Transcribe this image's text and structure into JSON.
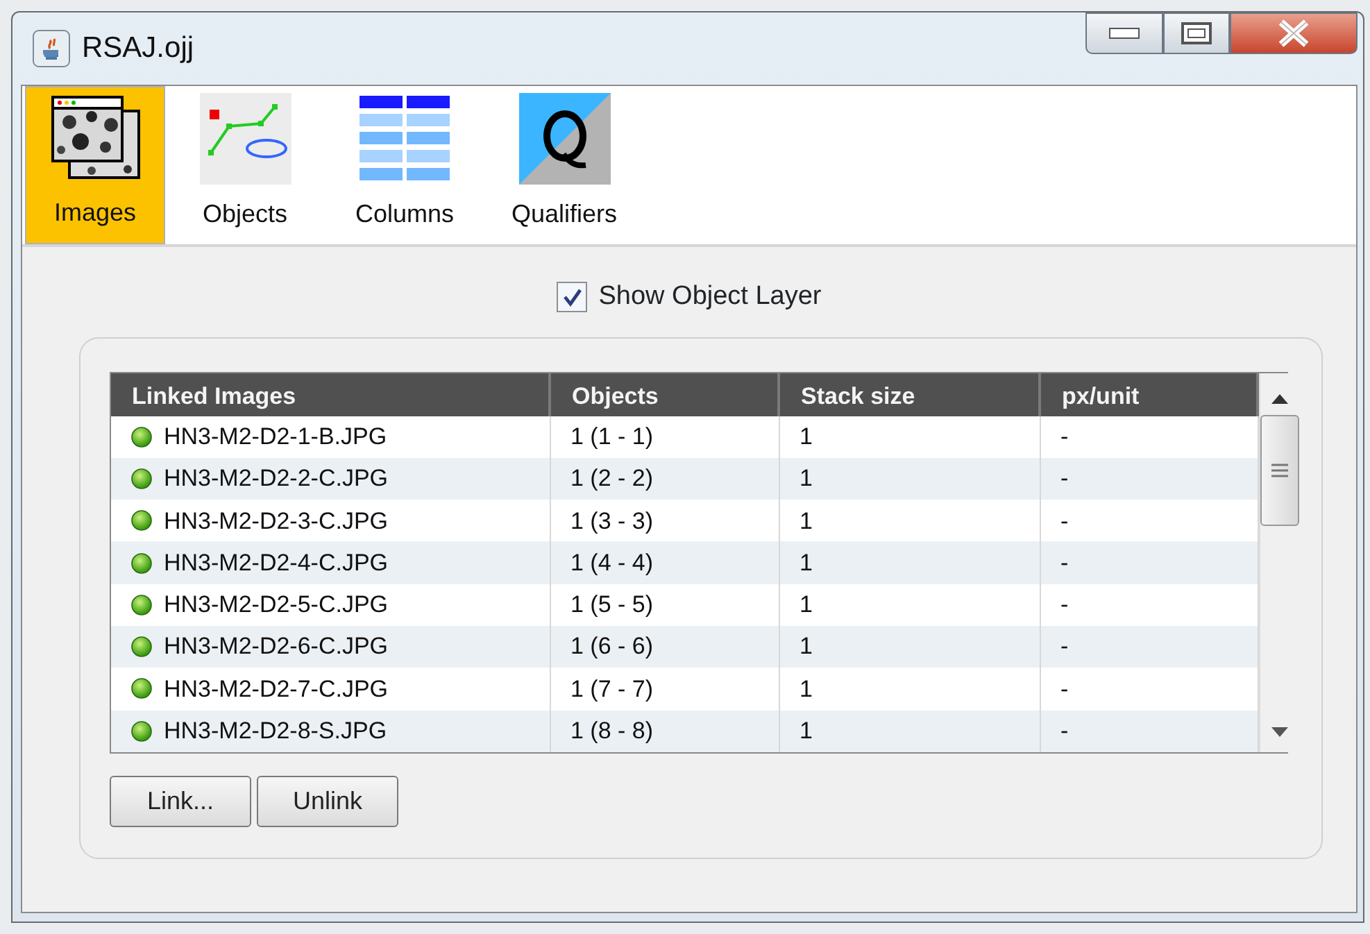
{
  "window": {
    "title": "RSAJ.ojj"
  },
  "tabs": [
    {
      "label": "Images",
      "kind": "images",
      "selected": true
    },
    {
      "label": "Objects",
      "kind": "objects",
      "selected": false
    },
    {
      "label": "Columns",
      "kind": "columns",
      "selected": false
    },
    {
      "label": "Qualifiers",
      "kind": "qualifiers",
      "selected": false
    }
  ],
  "show_object_layer": {
    "label": "Show Object Layer",
    "checked": true
  },
  "table": {
    "columns": [
      "Linked Images",
      "Objects",
      "Stack size",
      "px/unit"
    ],
    "rows": [
      [
        "HN3-M2-D2-1-B.JPG",
        "1 (1 - 1)",
        "1",
        "-"
      ],
      [
        "HN3-M2-D2-2-C.JPG",
        "1 (2 - 2)",
        "1",
        "-"
      ],
      [
        "HN3-M2-D2-3-C.JPG",
        "1 (3 - 3)",
        "1",
        "-"
      ],
      [
        "HN3-M2-D2-4-C.JPG",
        "1 (4 - 4)",
        "1",
        "-"
      ],
      [
        "HN3-M2-D2-5-C.JPG",
        "1 (5 - 5)",
        "1",
        "-"
      ],
      [
        "HN3-M2-D2-6-C.JPG",
        "1 (6 - 6)",
        "1",
        "-"
      ],
      [
        "HN3-M2-D2-7-C.JPG",
        "1 (7 - 7)",
        "1",
        "-"
      ],
      [
        "HN3-M2-D2-8-S.JPG",
        "1 (8 - 8)",
        "1",
        "-"
      ]
    ]
  },
  "buttons": [
    "Link...",
    "Unlink"
  ]
}
